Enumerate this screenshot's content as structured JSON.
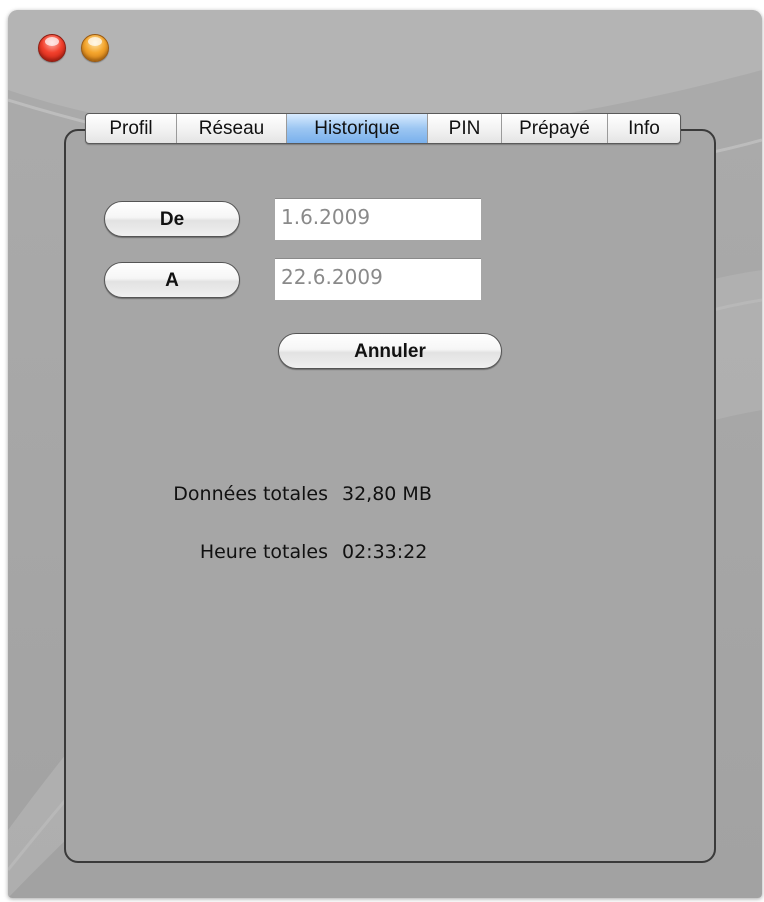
{
  "window": {
    "controls": [
      "close-button",
      "minimize-button"
    ]
  },
  "tabs": [
    {
      "label": "Profil",
      "selected": false
    },
    {
      "label": "Réseau",
      "selected": false
    },
    {
      "label": "Historique",
      "selected": true
    },
    {
      "label": "PIN",
      "selected": false
    },
    {
      "label": "Prépayé",
      "selected": false
    },
    {
      "label": "Info",
      "selected": false
    }
  ],
  "history": {
    "from_button": "De",
    "from_value": "1.6.2009",
    "to_button": "A",
    "to_value": "22.6.2009",
    "cancel_button": "Annuler"
  },
  "stats": {
    "data_label": "Données totales",
    "data_value": "32,80 MB",
    "time_label": "Heure totales",
    "time_value": "02:33:22"
  }
}
